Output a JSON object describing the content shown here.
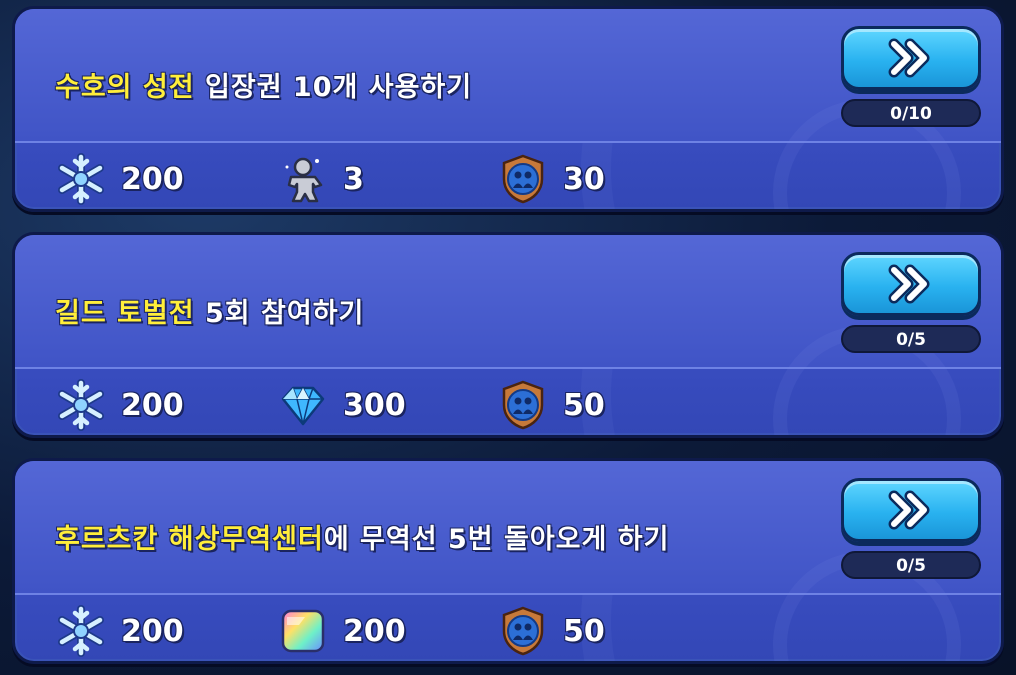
{
  "quests": [
    {
      "title_highlight": "수호의 성전",
      "title_rest": " 입장권 10개 사용하기",
      "progress": "0/10",
      "rewards": [
        {
          "icon": "snowflake-icon",
          "value": "200"
        },
        {
          "icon": "cookie-silhouette-icon",
          "value": "3"
        },
        {
          "icon": "guild-emblem-icon",
          "value": "30"
        }
      ]
    },
    {
      "title_highlight": "길드 토벌전",
      "title_rest": " 5회 참여하기",
      "progress": "0/5",
      "rewards": [
        {
          "icon": "snowflake-icon",
          "value": "200"
        },
        {
          "icon": "crystal-icon",
          "value": "300"
        },
        {
          "icon": "guild-emblem-icon",
          "value": "50"
        }
      ]
    },
    {
      "title_highlight": "후르츠칸 해상무역센터",
      "title_rest": "에 무역선 5번 돌아오게 하기",
      "progress": "0/5",
      "rewards": [
        {
          "icon": "snowflake-icon",
          "value": "200"
        },
        {
          "icon": "rainbow-cube-icon",
          "value": "200"
        },
        {
          "icon": "guild-emblem-icon",
          "value": "50"
        }
      ]
    }
  ],
  "colors": {
    "highlight": "#ffee3a",
    "card": "#4054c6",
    "button": "#29b2f0"
  }
}
